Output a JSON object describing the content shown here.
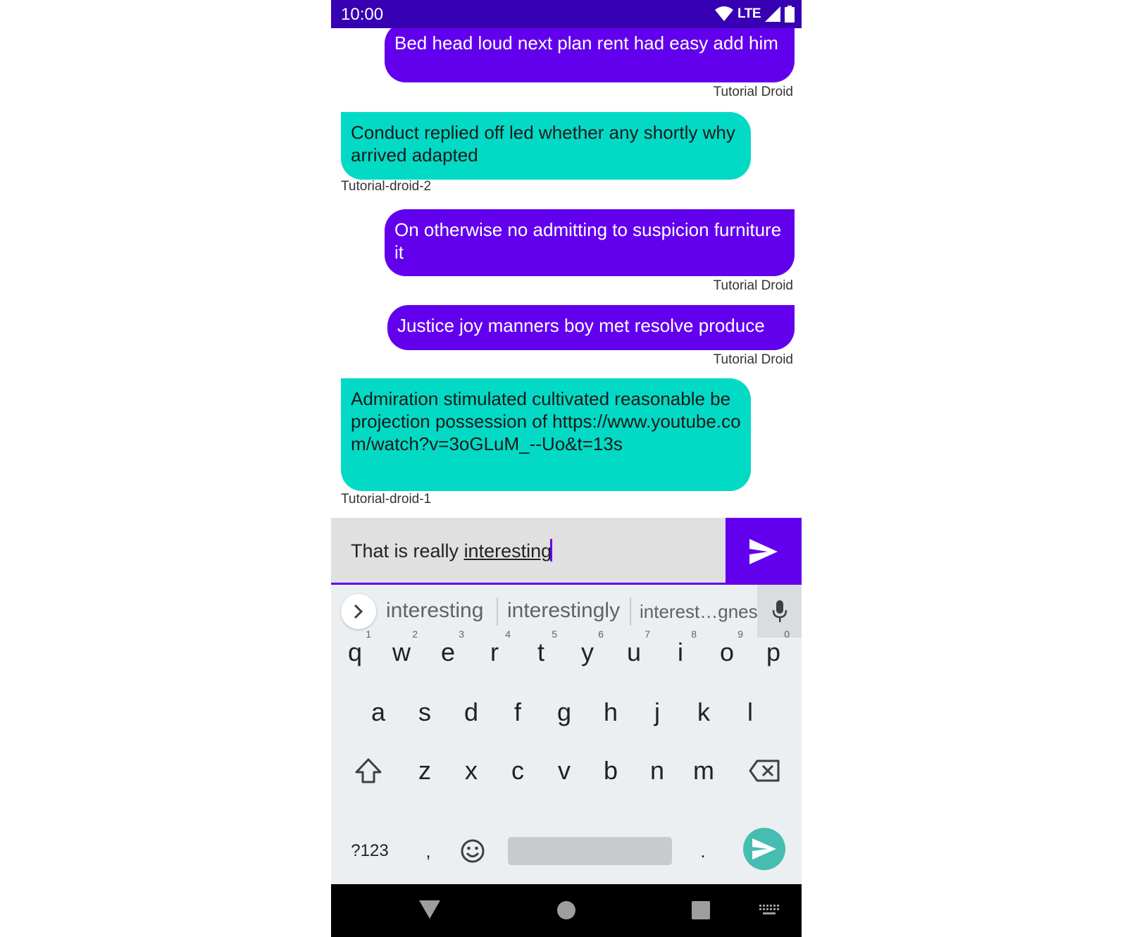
{
  "status_bar": {
    "time": "10:00",
    "network": "LTE"
  },
  "messages": [
    {
      "type": "sent",
      "text": "Bed head loud next plan rent had easy add him",
      "sender": "Tutorial Droid"
    },
    {
      "type": "received",
      "text": "Conduct replied off led whether any shortly why arrived adapted",
      "sender": "Tutorial-droid-2"
    },
    {
      "type": "sent",
      "text": "On otherwise no admitting to suspicion furniture it",
      "sender": "Tutorial Droid"
    },
    {
      "type": "sent",
      "text": "Justice joy manners boy met resolve produce",
      "sender": "Tutorial Droid"
    },
    {
      "type": "received",
      "text": "Admiration stimulated cultivated reasonable be projection possession of https://www.youtube.com/watch?v=3oGLuM_--Uo&t=13s",
      "sender": "Tutorial-droid-1"
    }
  ],
  "composer": {
    "prefix": "That is really ",
    "composing_word": "interesting"
  },
  "keyboard": {
    "suggestions": [
      "interesting",
      "interestingly",
      "interest…gness"
    ],
    "row1": [
      {
        "key": "q",
        "hint": "1"
      },
      {
        "key": "w",
        "hint": "2"
      },
      {
        "key": "e",
        "hint": "3"
      },
      {
        "key": "r",
        "hint": "4"
      },
      {
        "key": "t",
        "hint": "5"
      },
      {
        "key": "y",
        "hint": "6"
      },
      {
        "key": "u",
        "hint": "7"
      },
      {
        "key": "i",
        "hint": "8"
      },
      {
        "key": "o",
        "hint": "9"
      },
      {
        "key": "p",
        "hint": "0"
      }
    ],
    "row2": [
      "a",
      "s",
      "d",
      "f",
      "g",
      "h",
      "j",
      "k",
      "l"
    ],
    "row3": [
      "z",
      "x",
      "c",
      "v",
      "b",
      "n",
      "m"
    ],
    "symbols_label": "?123",
    "comma": ",",
    "period": "."
  },
  "colors": {
    "sent_bubble": "#6200ee",
    "received_bubble": "#03dac5",
    "status_bar": "#3700b3",
    "accent": "#6200ee",
    "enter_key": "#46bdb0"
  },
  "icons": [
    "wifi-icon",
    "signal-icon",
    "battery-icon",
    "send-icon",
    "chevron-right-icon",
    "microphone-icon",
    "shift-icon",
    "backspace-icon",
    "emoji-icon",
    "back-nav-icon",
    "home-nav-icon",
    "recents-nav-icon",
    "keyboard-switch-icon"
  ]
}
